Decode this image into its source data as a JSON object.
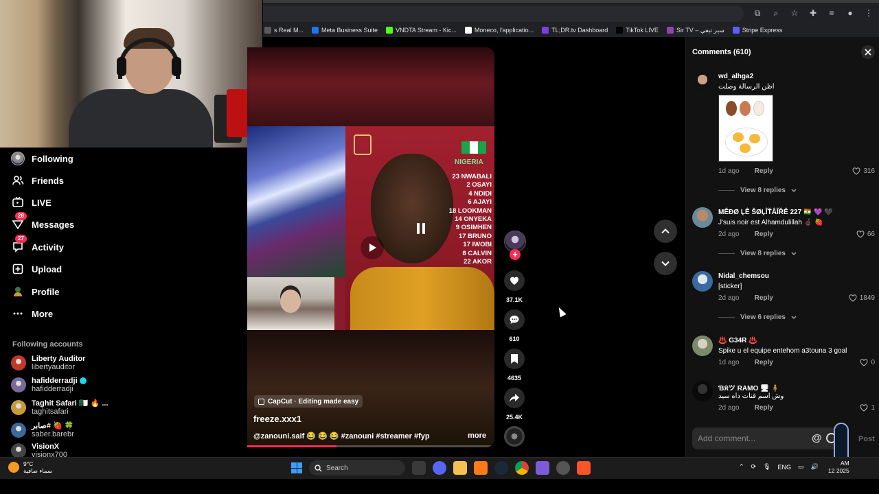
{
  "bookmarks": [
    {
      "label": "s Real M...",
      "color": "#5a5a5a"
    },
    {
      "label": "Meta Business Suite",
      "color": "#1877f2"
    },
    {
      "label": "VNDTA Stream - Kic...",
      "color": "#53fc18"
    },
    {
      "label": "Moneco, l'applicatio...",
      "color": "#ffffff"
    },
    {
      "label": "TL;DR.tv Dashboard",
      "color": "#7b3fe4"
    },
    {
      "label": "TikTok LIVE",
      "color": "#000000"
    },
    {
      "label": "Sir TV – سير تيفي",
      "color": "#8e44ad"
    },
    {
      "label": "Stripe Express",
      "color": "#635bff"
    }
  ],
  "sidebar": {
    "nav": [
      {
        "label": "Following",
        "icon": "following-avatar-icon"
      },
      {
        "label": "Friends",
        "icon": "friends-icon"
      },
      {
        "label": "LIVE",
        "icon": "live-icon"
      },
      {
        "label": "Messages",
        "icon": "messages-icon",
        "badge": "28"
      },
      {
        "label": "Activity",
        "icon": "activity-icon",
        "badge": "27"
      },
      {
        "label": "Upload",
        "icon": "upload-icon"
      },
      {
        "label": "Profile",
        "icon": "profile-icon"
      },
      {
        "label": "More",
        "icon": "more-icon"
      }
    ],
    "following_title": "Following accounts",
    "accounts": [
      {
        "name": "Liberty Auditor",
        "handle": "libertyauditor",
        "color": "#c0392b"
      },
      {
        "name": "hafidderradji",
        "handle": "hafidderradji",
        "color": "#7a6a9a",
        "verified": true
      },
      {
        "name": "Taghit Safari 🇩🇿 🔥 ...",
        "handle": "taghitsafari",
        "color": "#c69c3a"
      },
      {
        "name": "صابر# 🍓 🍀",
        "handle": "saber.barebr",
        "color": "#3a6a9a"
      },
      {
        "name": "VisionX",
        "handle": "visionx700",
        "color": "#444444"
      }
    ]
  },
  "video": {
    "country": "NIGERIA",
    "lineup": [
      "23 NWABALI",
      "2 OSAYI",
      "4 NDIDI",
      "6 AJAYI",
      "18 LOOKMAN",
      "14 ONYEKA",
      "9 OSIMHEN",
      "17 BRUNO",
      "17 IWOBI",
      "8 CALVIN",
      "22 AKOR"
    ],
    "capcut": "CapCut · Editing made easy",
    "author": "freeze.xxx1",
    "description": "@zanouni.saif 😂 😂 😂 #zanouni #streamer #fyp ...",
    "more": "more",
    "progress": 0.36
  },
  "actions": {
    "likes": "37.1K",
    "comments": "610",
    "saves": "4635",
    "shares": "25.4K"
  },
  "comments": {
    "title": "Comments (610)",
    "items": [
      {
        "user": "wd_alhga2",
        "text": "اظن الرسالة وصلت",
        "time": "1d ago",
        "reply": "Reply",
        "likes": "316",
        "view_replies": "View 8 replies",
        "color": "#2a2a2a",
        "sticker": true
      },
      {
        "user": "MÊÐØ ĻÊ ŠØĻÎŤÂÎŘÊ 227 🇳🇪 💜 🖤",
        "text": "J'suis noir est Alhamdulillah 🤞🏿 🍓",
        "time": "2d ago",
        "reply": "Reply",
        "likes": "66",
        "view_replies": "View 8 replies",
        "color": "#8a6a5a"
      },
      {
        "user": "Nidal_chemsou",
        "text": "[sticker]",
        "time": "2d ago",
        "reply": "Reply",
        "likes": "1849",
        "view_replies": "View 6 replies",
        "color": "#5a7aa0"
      },
      {
        "user": "♨️ G34R ♨️",
        "text": "Spike u el equipe entehom a3touna 3 goal",
        "time": "1d ago",
        "reply": "Reply",
        "likes": "0",
        "color": "#6a7a5a"
      },
      {
        "user": "Ɓ𝔎ツ RAMO 🖥 🧍",
        "text": "وش اسم قنات داه سيد",
        "time": "2d ago",
        "reply": "Reply",
        "likes": "1",
        "color": "#1a1a1a"
      }
    ],
    "add_placeholder": "Add comment...",
    "post": "Post"
  },
  "taskbar": {
    "temp": "9°C",
    "weather": "سماء صافية",
    "search": "Search",
    "lang": "ENG",
    "time": "AM",
    "date": "12 2025"
  },
  "colors": {
    "accent": "#fe2c55",
    "panel": "#121212"
  }
}
